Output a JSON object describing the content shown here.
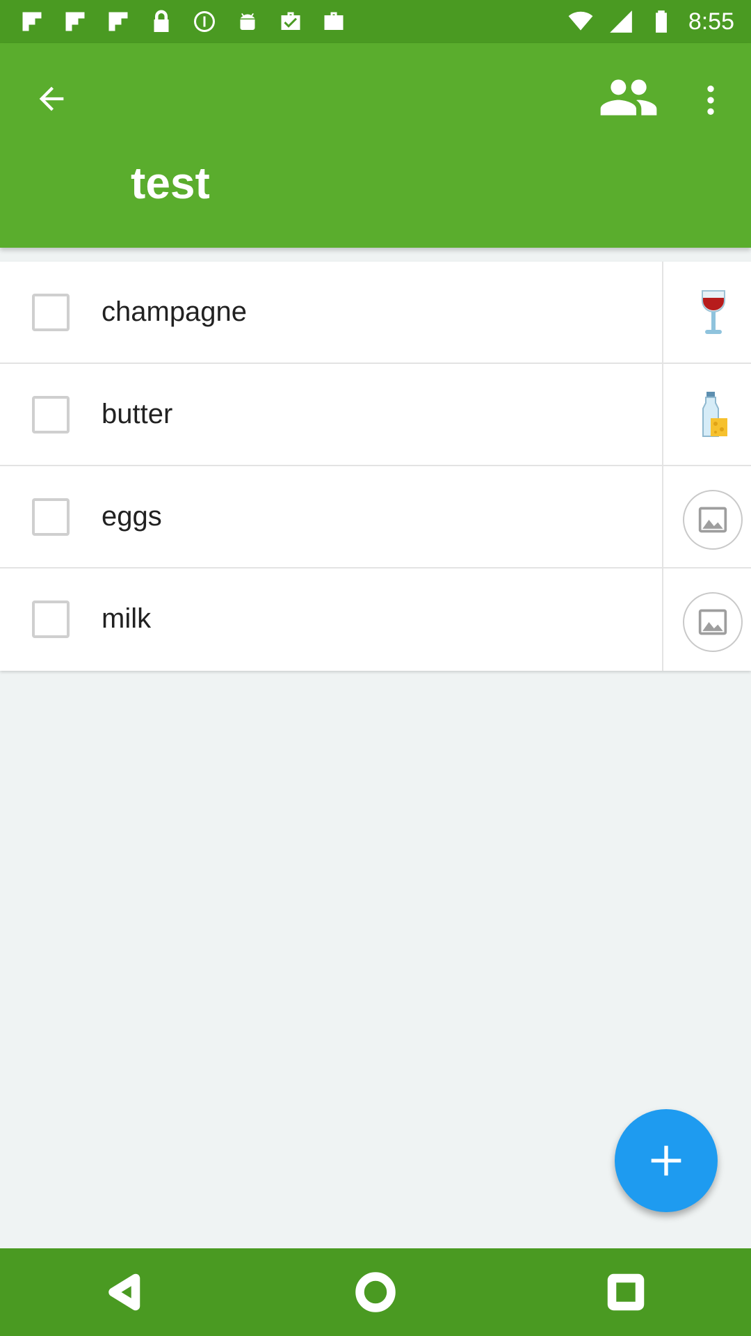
{
  "status_bar": {
    "time": "8:55",
    "notification_icons": [
      "flipboard-icon",
      "flipboard-icon",
      "flipboard-icon",
      "lock-icon",
      "info-icon",
      "android-icon",
      "briefcase-check-icon",
      "briefcase-icon"
    ],
    "system_icons": [
      "wifi-icon",
      "signal-icon",
      "battery-icon"
    ]
  },
  "app_bar": {
    "title": "test",
    "back_icon": "arrow-back-icon",
    "people_icon": "people-icon",
    "more_icon": "more-vert-icon",
    "color": "#5aad2d"
  },
  "items": [
    {
      "label": "champagne",
      "checked": false,
      "image": "wine-glass-icon"
    },
    {
      "label": "butter",
      "checked": false,
      "image": "milk-cheese-icon"
    },
    {
      "label": "eggs",
      "checked": false,
      "image": "image-placeholder-icon"
    },
    {
      "label": "milk",
      "checked": false,
      "image": "image-placeholder-icon"
    }
  ],
  "fab": {
    "icon": "plus-icon",
    "color": "#1e9bf0"
  },
  "nav_bar": {
    "back": "nav-back-icon",
    "home": "nav-home-icon",
    "recents": "nav-recents-icon"
  }
}
